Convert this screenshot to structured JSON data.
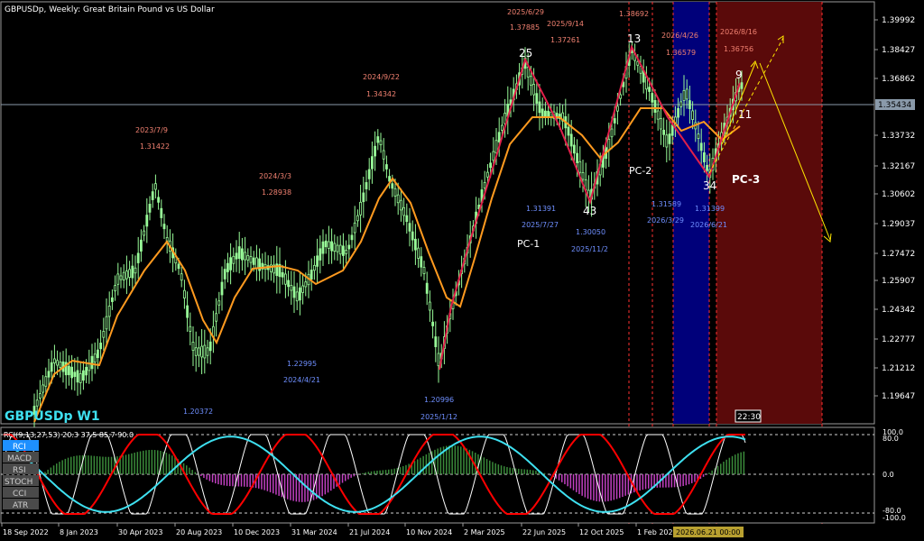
{
  "header": {
    "title": "GBPUSDp, Weekly:  Great Britain Pound vs US Dollar"
  },
  "watermark": "GBPUSDp W1",
  "price_axis": {
    "ticks": [
      "1.39992",
      "1.38427",
      "1.36862",
      "1.35434",
      "1.33732",
      "1.32167",
      "1.30602",
      "1.29037",
      "1.27472",
      "1.25907",
      "1.24342",
      "1.22777",
      "1.21212",
      "1.19647"
    ],
    "current_price": "1.35434",
    "countdown": "22:30"
  },
  "time_axis": {
    "labels": [
      "18 Sep 2022",
      "8 Jan 2023",
      "30 Apr 2023",
      "20 Aug 2023",
      "10 Dec 2023",
      "31 Mar 2024",
      "21 Jul 2024",
      "10 Nov 2024",
      "2 Mar 2025",
      "22 Jun 2025",
      "12 Oct 2025",
      "1 Feb 202"
    ],
    "cursor_label": "2026.06.21 00:00"
  },
  "annotations": {
    "highs": [
      {
        "date": "2023/7/9",
        "price": "1.31422"
      },
      {
        "date": "2024/3/3",
        "price": "1.28938"
      },
      {
        "date": "2024/9/22",
        "price": "1.34342"
      },
      {
        "date": "2025/6/29",
        "price": "1.37885"
      },
      {
        "date": "2025/9/14",
        "price": "1.37261"
      },
      {
        "date": "",
        "price": "1.38692"
      },
      {
        "date": "2026/4/26",
        "price": "1.36579"
      },
      {
        "date": "2026/8/16",
        "price": "1.36756"
      }
    ],
    "lows": [
      {
        "date": "2024/4/21",
        "price": "1.22995"
      },
      {
        "date": "",
        "price": "1.20372"
      },
      {
        "date": "2025/1/12",
        "price": "1.20996"
      },
      {
        "date": "2025/7/27",
        "price": "1.31391"
      },
      {
        "date": "2025/11/2",
        "price": "1.30050"
      },
      {
        "date": "2026/3/29",
        "price": "1.31589"
      },
      {
        "date": "2026/6/21",
        "price": "1.31399"
      }
    ],
    "counts": [
      "25",
      "43",
      "13",
      "34",
      "9",
      "11"
    ],
    "phases": [
      "PC-1",
      "PC-2",
      "PC-3"
    ]
  },
  "indicator": {
    "label": "RCI(9,13,27,53) 20.3 37.5 85.7 90.0",
    "levels": [
      "100.0",
      "80.0",
      "0.0",
      "-80.0",
      "-100.0"
    ],
    "buttons": [
      "RCI",
      "MACD",
      "RSI",
      "STOCH",
      "CCI",
      "ATR"
    ]
  },
  "colors": {
    "bull_candle": "#98fb98",
    "ma_line": "#ff9a1f",
    "trend_line": "#e0204a",
    "projection": "#ffe600",
    "blue_zone": "#00007a",
    "red_zone": "#5a0a0a",
    "rci_white": "#ffffff",
    "rci_red": "#ff0000",
    "rci_cyan": "#3ee0f0",
    "macd_green": "#3a8a3a",
    "macd_magenta": "#c040c0",
    "high_text": "#f08070",
    "low_text": "#6f8fff"
  }
}
